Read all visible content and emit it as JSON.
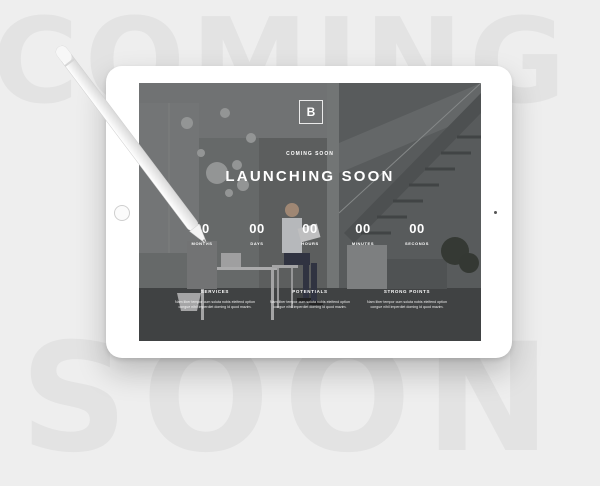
{
  "background_words": {
    "top": "COMING",
    "bottom": "SOON"
  },
  "page": {
    "logo": "B",
    "kicker": "COMING SOON",
    "title": "LAUNCHING SOON"
  },
  "countdown": [
    {
      "value": "00",
      "label": "MONTHS"
    },
    {
      "value": "00",
      "label": "DAYS"
    },
    {
      "value": "00",
      "label": "HOURS"
    },
    {
      "value": "00",
      "label": "MINUTES"
    },
    {
      "value": "00",
      "label": "SECONDS"
    }
  ],
  "features": [
    {
      "title": "SERVICES",
      "line1": "Nam liber tempor cum soluta nobis eleifend option",
      "line2": "congue nihil imperdiet doming id quod mazim."
    },
    {
      "title": "POTENTIALS",
      "line1": "Nam liber tempor cum soluta nobis eleifend option",
      "line2": "congue nihil imperdiet doming id quod mazim."
    },
    {
      "title": "STRONG POINTS",
      "line1": "Nam liber tempor cum soluta nobis eleifend option",
      "line2": "congue nihil imperdiet doming id quod mazim."
    }
  ],
  "colors": {
    "background": "#eeeeee",
    "tablet": "#ffffff",
    "text": "#ffffff",
    "overlay": "#232526"
  }
}
